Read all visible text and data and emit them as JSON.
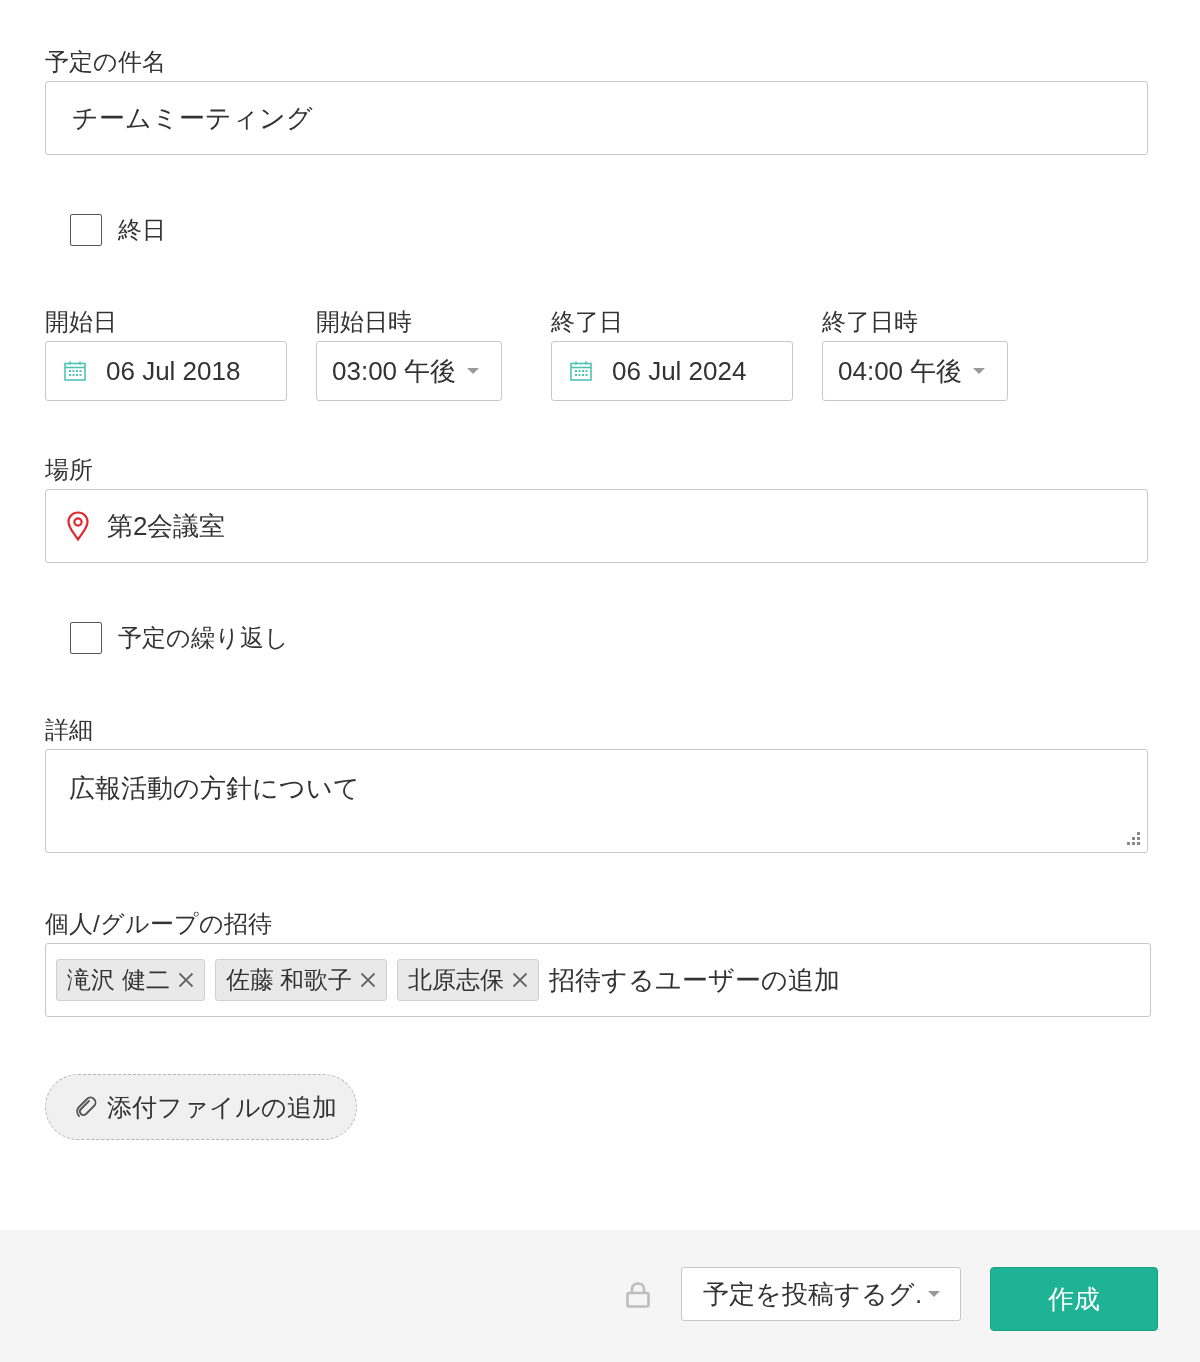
{
  "title_field": {
    "label": "予定の件名",
    "value": "チームミーティング"
  },
  "all_day": {
    "label": "終日",
    "checked": false
  },
  "datetime": [
    {
      "kind": "date",
      "label": "開始日",
      "value": "06 Jul 2018"
    },
    {
      "kind": "time",
      "label": "開始日時",
      "value": "03:00 午後"
    },
    {
      "kind": "date",
      "label": "終了日",
      "value": "06 Jul 2024"
    },
    {
      "kind": "time",
      "label": "終了日時",
      "value": "04:00 午後"
    }
  ],
  "location": {
    "label": "場所",
    "value": "第2会議室"
  },
  "repeat": {
    "label": "予定の繰り返し",
    "checked": false
  },
  "details": {
    "label": "詳細",
    "value": "広報活動の方針について"
  },
  "invite": {
    "label": "個人/グループの招待",
    "tags": [
      "滝沢 健二",
      "佐藤 和歌子",
      "北原志保"
    ],
    "placeholder": "招待するユーザーの追加"
  },
  "attach_button": "添付ファイルの追加",
  "footer": {
    "post_to": "予定を投稿するグ.",
    "create": "作成"
  }
}
